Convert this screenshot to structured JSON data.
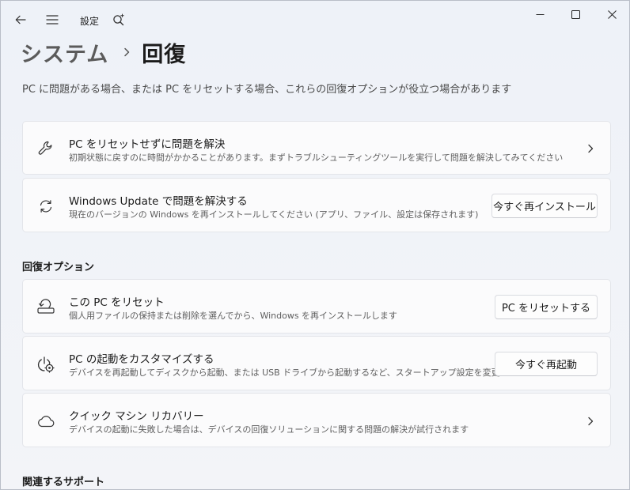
{
  "titlebar": {
    "title": "設定"
  },
  "breadcrumb": {
    "parent": "システム",
    "current": "回復"
  },
  "intro": "PC に問題がある場合、または PC をリセットする場合、これらの回復オプションが役立つ場合があります",
  "cards_top": [
    {
      "title": "PC をリセットせずに問題を解決",
      "desc": "初期状態に戻すのに時間がかかることがあります。まずトラブルシューティングツールを実行して問題を解決してみてください",
      "icon": "wrench-icon",
      "action": "chevron"
    },
    {
      "title": "Windows Update で問題を解決する",
      "desc": "現在のバージョンの Windows を再インストールしてください (アプリ、ファイル、設定は保存されます)",
      "icon": "sync-icon",
      "button": "今すぐ再インストール"
    }
  ],
  "recovery_options": {
    "heading": "回復オプション",
    "items": [
      {
        "title": "この PC をリセット",
        "desc": "個人用ファイルの保持または削除を選んでから、Windows を再インストールします",
        "icon": "reset-pc-icon",
        "button": "PC をリセットする"
      },
      {
        "title": "PC の起動をカスタマイズする",
        "desc": "デバイスを再起動してディスクから起動、または USB ドライブから起動するなど、スタートアップ設定を変更する",
        "icon": "power-gear-icon",
        "button": "今すぐ再起動"
      },
      {
        "title": "クイック マシン リカバリー",
        "desc": "デバイスの起動に失敗した場合は、デバイスの回復ソリューションに関する問題の解決が試行されます",
        "icon": "cloud-icon",
        "action": "chevron"
      }
    ]
  },
  "related": {
    "heading": "関連するサポート"
  }
}
